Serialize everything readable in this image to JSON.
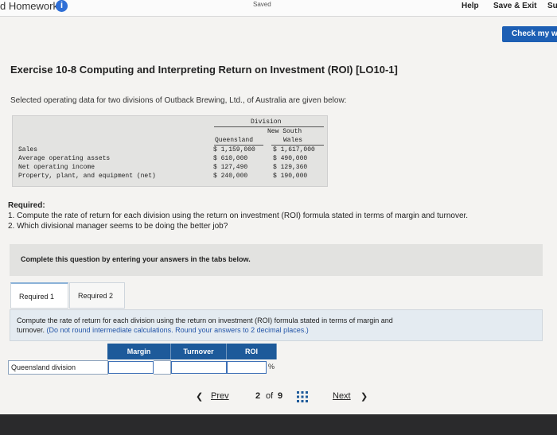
{
  "topbar": {
    "app_title": "d Homework",
    "saved": "Saved",
    "help": "Help",
    "save_exit": "Save & Exit",
    "submit": "Su"
  },
  "check_button": "Check my w",
  "exercise_title": "Exercise 10-8 Computing and Interpreting Return on Investment (ROI) [LO10-1]",
  "intro": "Selected operating data for two divisions of Outback Brewing, Ltd., of Australia are given below:",
  "data_table": {
    "group_header": "Division",
    "col1_header": "Queensland",
    "col2_header_line1": "New South",
    "col2_header_line2": "Wales",
    "rows": [
      {
        "label": "Sales",
        "q": "$ 1,159,000",
        "n": "$ 1,617,000"
      },
      {
        "label": "Average operating assets",
        "q": "$   610,000",
        "n": "$   490,000"
      },
      {
        "label": "Net operating income",
        "q": "$   127,490",
        "n": "$   129,360"
      },
      {
        "label": "Property, plant, and equipment (net)",
        "q": "$   240,000",
        "n": "$   190,000"
      }
    ]
  },
  "required": {
    "heading": "Required:",
    "item1": "1. Compute the rate of return for each division using the return on investment (ROI) formula stated in terms of margin and turnover.",
    "item2": "2. Which divisional manager seems to be doing the better job?"
  },
  "complete_prompt": "Complete this question by entering your answers in the tabs below.",
  "tabs": [
    {
      "label": "Required 1"
    },
    {
      "label": "Required 2"
    }
  ],
  "instructions": {
    "line1": "Compute the rate of return for each division using the return on investment (ROI) formula stated in terms of margin and",
    "line2_start": "turnover. ",
    "line2_blue": "(Do not round intermediate calculations. Round your answers to 2 decimal places.)"
  },
  "answer_table": {
    "headers": [
      "Margin",
      "Turnover",
      "ROI"
    ],
    "row_label": "Queensland division",
    "unit": "%"
  },
  "pagination": {
    "prev": "Prev",
    "current": "2",
    "of_label": "of",
    "total": "9",
    "next": "Next"
  }
}
